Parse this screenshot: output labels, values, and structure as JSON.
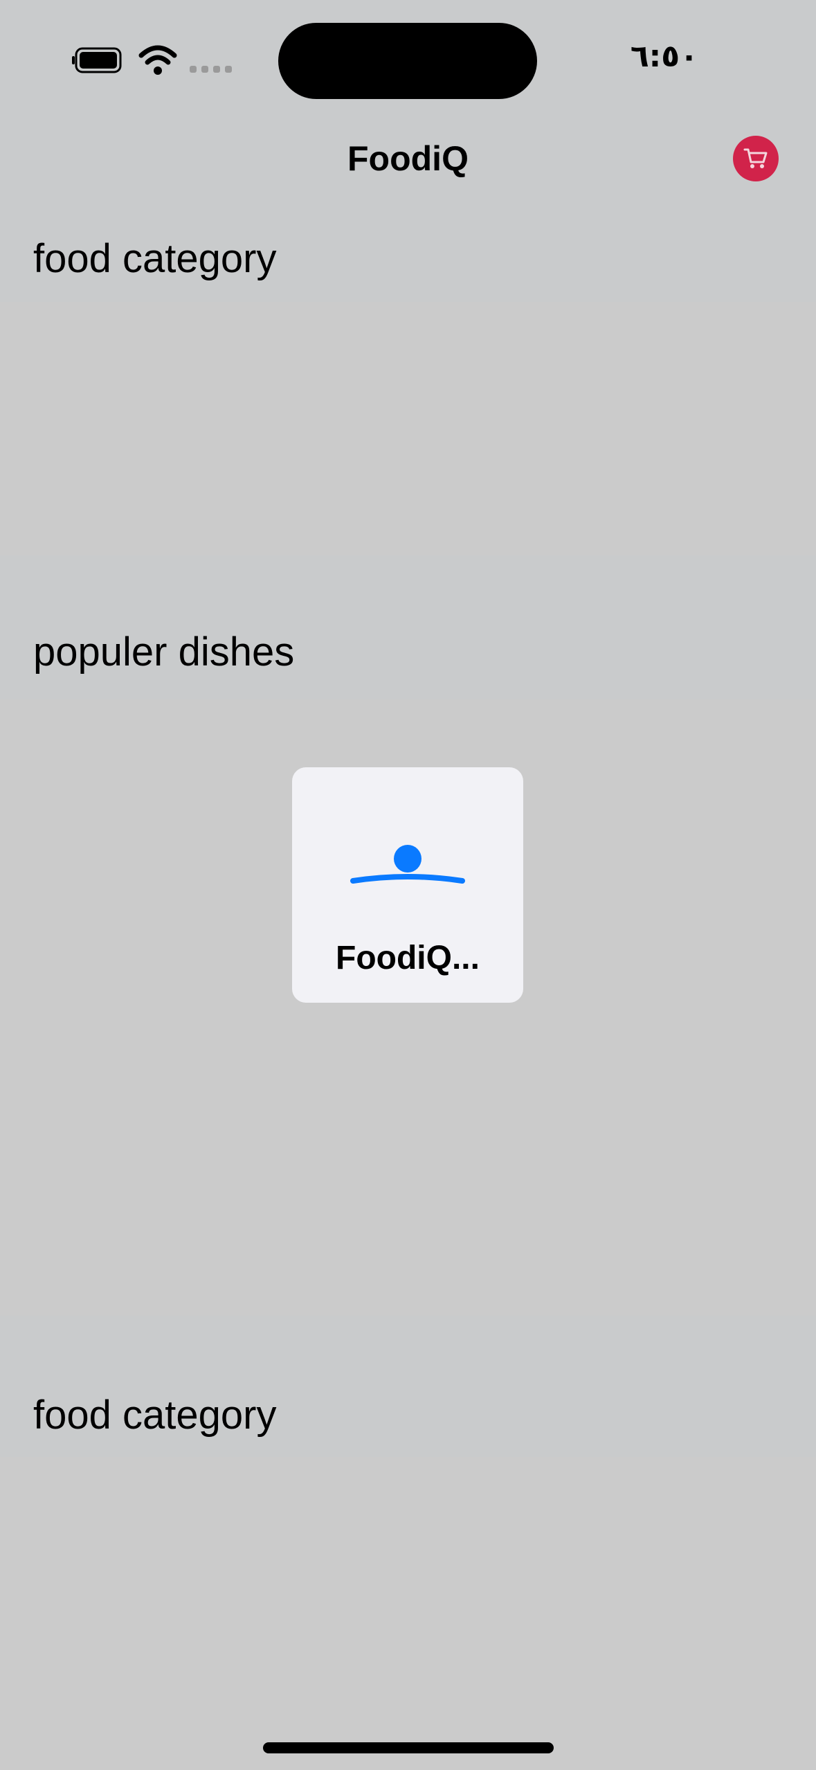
{
  "status_bar": {
    "time": "٦:٥٠",
    "icons": [
      "battery-icon",
      "wifi-icon",
      "signal-icon"
    ]
  },
  "nav": {
    "title": "FoodiQ",
    "cart_icon": "cart-icon",
    "accent_color": "#d1234a"
  },
  "sections": {
    "food_category_top": "food category",
    "popular_dishes": "populer dishes",
    "food_category_bottom": "food category"
  },
  "loading": {
    "label": "FoodiQ...",
    "indicator_color": "#0a7aff"
  },
  "colors": {
    "background": "#c9cbcc",
    "band": "#cbcbcb",
    "card": "#f2f2f6"
  }
}
